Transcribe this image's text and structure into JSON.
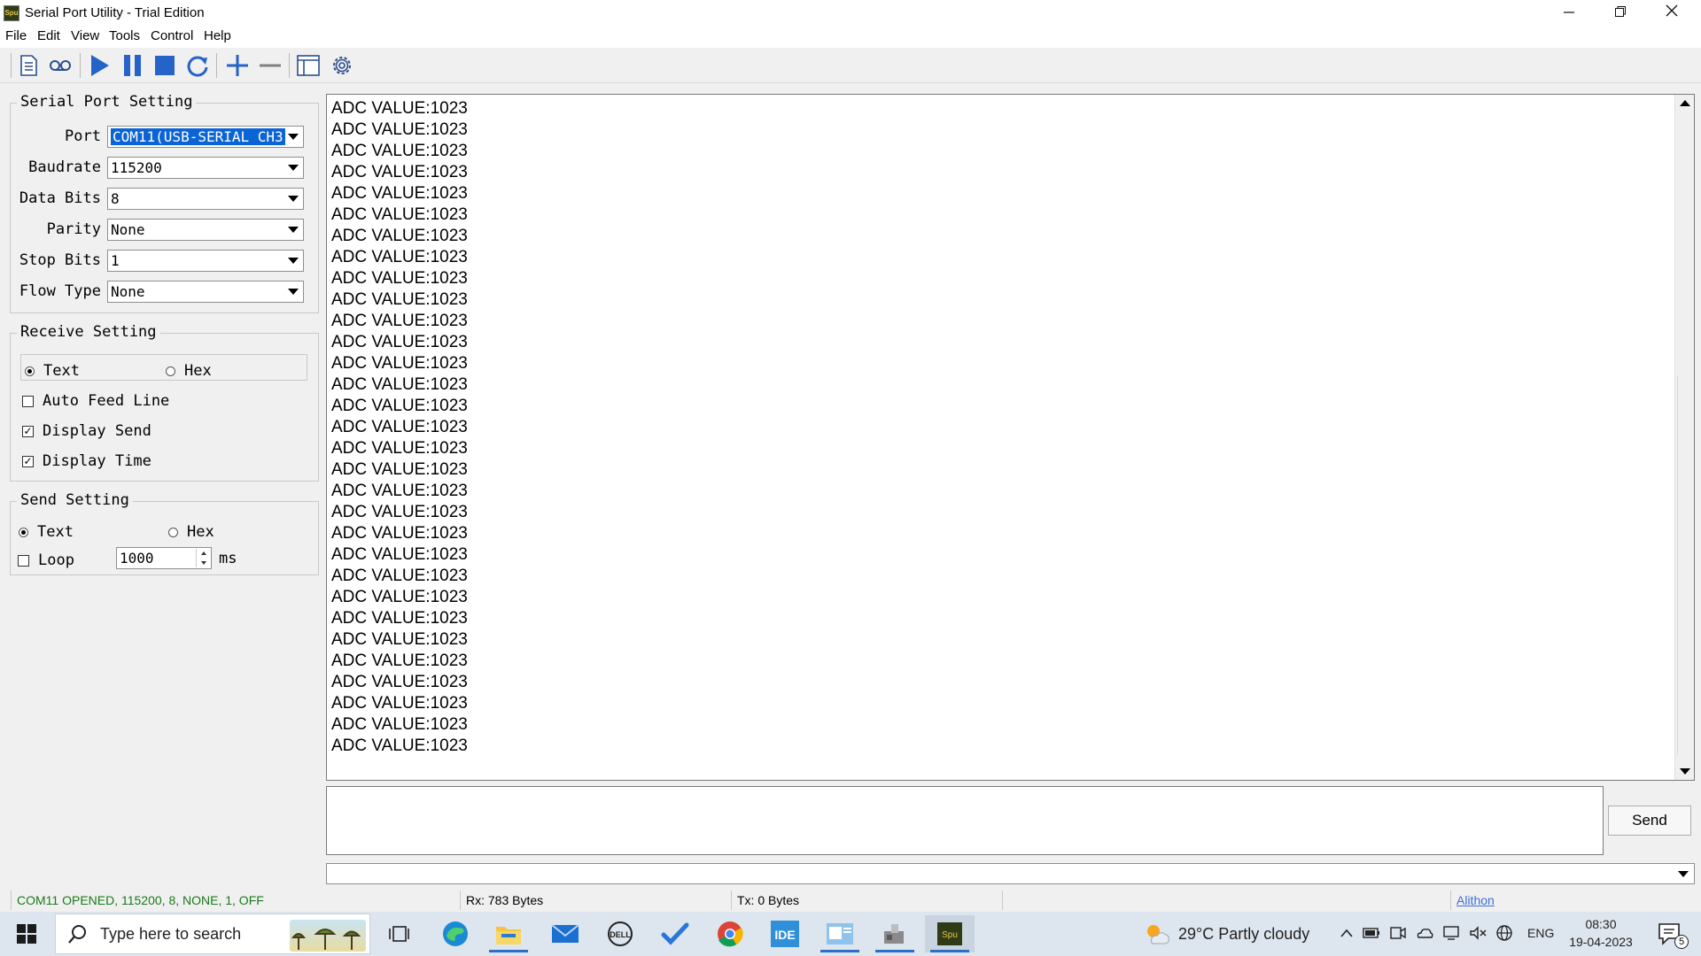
{
  "window": {
    "title": "Serial Port Utility - Trial Edition",
    "app_icon_text": "Spu"
  },
  "menu": [
    "File",
    "Edit",
    "View",
    "Tools",
    "Control",
    "Help"
  ],
  "serial_setting": {
    "title": "Serial Port Setting",
    "port": {
      "label": "Port",
      "value": "COM11(USB-SERIAL CH3"
    },
    "baudrate": {
      "label": "Baudrate",
      "value": "115200"
    },
    "databits": {
      "label": "Data Bits",
      "value": "8"
    },
    "parity": {
      "label": "Parity",
      "value": "None"
    },
    "stopbits": {
      "label": "Stop Bits",
      "value": "1"
    },
    "flowtype": {
      "label": "Flow Type",
      "value": "None"
    }
  },
  "receive_setting": {
    "title": "Receive Setting",
    "text_label": "Text",
    "hex_label": "Hex",
    "selected": "Text",
    "auto_feed_line": {
      "label": "Auto Feed Line",
      "checked": false
    },
    "display_send": {
      "label": "Display Send",
      "checked": true
    },
    "display_time": {
      "label": "Display Time",
      "checked": true
    }
  },
  "send_setting": {
    "title": "Send Setting",
    "text_label": "Text",
    "hex_label": "Hex",
    "selected": "Text",
    "loop": {
      "label": "Loop",
      "checked": false
    },
    "interval": "1000",
    "unit": "ms"
  },
  "receive_lines": [
    "ADC VALUE:1023",
    "ADC VALUE:1023",
    "ADC VALUE:1023",
    "ADC VALUE:1023",
    "ADC VALUE:1023",
    "ADC VALUE:1023",
    "ADC VALUE:1023",
    "ADC VALUE:1023",
    "ADC VALUE:1023",
    "ADC VALUE:1023",
    "ADC VALUE:1023",
    "ADC VALUE:1023",
    "ADC VALUE:1023",
    "ADC VALUE:1023",
    "ADC VALUE:1023",
    "ADC VALUE:1023",
    "ADC VALUE:1023",
    "ADC VALUE:1023",
    "ADC VALUE:1023",
    "ADC VALUE:1023",
    "ADC VALUE:1023",
    "ADC VALUE:1023",
    "ADC VALUE:1023",
    "ADC VALUE:1023",
    "ADC VALUE:1023",
    "ADC VALUE:1023",
    "ADC VALUE:1023",
    "ADC VALUE:1023",
    "ADC VALUE:1023",
    "ADC VALUE:1023",
    "ADC VALUE:1023"
  ],
  "send": {
    "button_label": "Send",
    "text": ""
  },
  "status": {
    "connection": "COM11 OPENED, 115200, 8, NONE, 1, OFF",
    "rx": "Rx: 783 Bytes",
    "tx": "Tx: 0 Bytes",
    "link": "Alithon",
    "connection_color": "#1a7a1a",
    "link_color": "#3a6fd8"
  },
  "taskbar": {
    "search_placeholder": "Type here to search",
    "weather": "29°C  Partly cloudy",
    "language": "ENG",
    "time": "08:30",
    "date": "19-04-2023",
    "notification_count": "5",
    "apps": [
      "task-view",
      "edge",
      "file-explorer",
      "mail",
      "dell",
      "todo",
      "chrome",
      "arduino-ide",
      "outlook",
      "usb-tool",
      "serial-port-utility"
    ],
    "active_app": "serial-port-utility"
  },
  "toolbar_icons": [
    "new-document-icon",
    "record-icon",
    "play-icon",
    "pause-icon",
    "stop-icon",
    "refresh-icon",
    "add-icon",
    "remove-icon",
    "window-icon",
    "settings-icon"
  ]
}
